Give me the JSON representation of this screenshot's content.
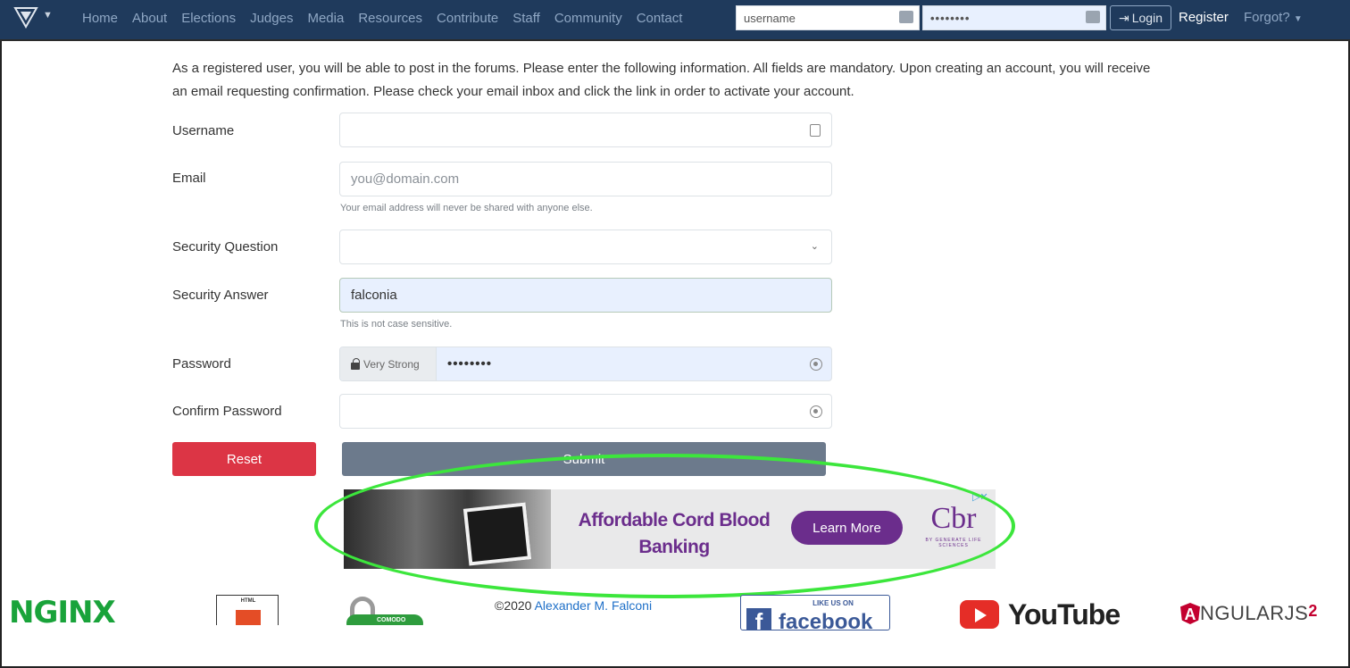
{
  "nav": {
    "links": [
      "Home",
      "About",
      "Elections",
      "Judges",
      "Media",
      "Resources",
      "Contribute",
      "Staff",
      "Community",
      "Contact"
    ],
    "username_value": "username",
    "password_value": "••••••••",
    "login_label": "Login",
    "register_label": "Register",
    "forgot_label": "Forgot?"
  },
  "intro": "As a registered user, you will be able to post in the forums. Please enter the following information. All fields are mandatory. Upon creating an account, you will receive an email requesting confirmation. Please check your email inbox and click the link in order to activate your account.",
  "form": {
    "username_label": "Username",
    "email_label": "Email",
    "email_placeholder": "you@domain.com",
    "email_hint": "Your email address will never be shared with anyone else.",
    "security_question_label": "Security Question",
    "security_answer_label": "Security Answer",
    "security_answer_value": "falconia",
    "security_answer_hint": "This is not case sensitive.",
    "password_label": "Password",
    "password_strength": "Very Strong",
    "password_value": "••••••••",
    "confirm_password_label": "Confirm Password",
    "reset_label": "Reset",
    "submit_label": "Submit"
  },
  "ad": {
    "headline": "Affordable Cord Blood Banking",
    "cta": "Learn More",
    "brand": "Cbr",
    "brand_sub": "BY GENERATE LIFE SCIENCES"
  },
  "footer": {
    "nginx": "NGINX",
    "html5": "HTML",
    "comodo": "COMODO",
    "copyright_prefix": "©2020 ",
    "copyright_name": "Alexander M. Falconi",
    "fb_like": "LIKE US ON",
    "fb_word": "facebook",
    "youtube": "YouTube",
    "angular": "NGULARJS",
    "angular_version": "2"
  },
  "colors": {
    "navbar": "#1f3a5c",
    "reset": "#dc3545",
    "submit": "#6c7a8c",
    "ad_purple": "#6b2d8c",
    "highlight": "#3ce63c"
  }
}
